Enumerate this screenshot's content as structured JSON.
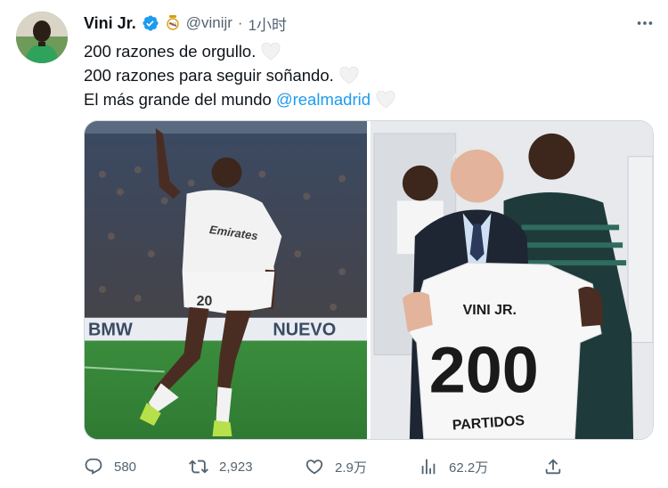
{
  "tweet": {
    "author_name": "Vini Jr.",
    "handle": "@vinijr",
    "separator": "·",
    "time": "1小时",
    "lines": [
      "200 razones de orgullo.",
      "200 razones para seguir soñando.",
      "El más grande del mundo"
    ],
    "mention": "@realmadrid"
  },
  "media": {
    "left_photo": {
      "banner_text": "BMW",
      "banner_text_right": "NUEVO",
      "jersey_text": "Emirates"
    },
    "right_photo": {
      "shirt_name": "VINI JR.",
      "shirt_number": "200",
      "shirt_caption": "PARTIDOS"
    }
  },
  "actions": {
    "reply_count": "580",
    "retweet_count": "2,923",
    "like_count": "2.9万",
    "view_count": "62.2万"
  },
  "colors": {
    "accent": "#1d9bf0",
    "muted": "#536471",
    "text": "#0f1419"
  },
  "icons": {
    "verified": "verified-badge-icon",
    "crest": "real-madrid-crest-icon",
    "more": "more-options-icon",
    "heart": "white-heart-emoji-icon",
    "reply": "reply-icon",
    "retweet": "retweet-icon",
    "like": "like-icon",
    "views": "views-icon",
    "share": "share-icon"
  }
}
